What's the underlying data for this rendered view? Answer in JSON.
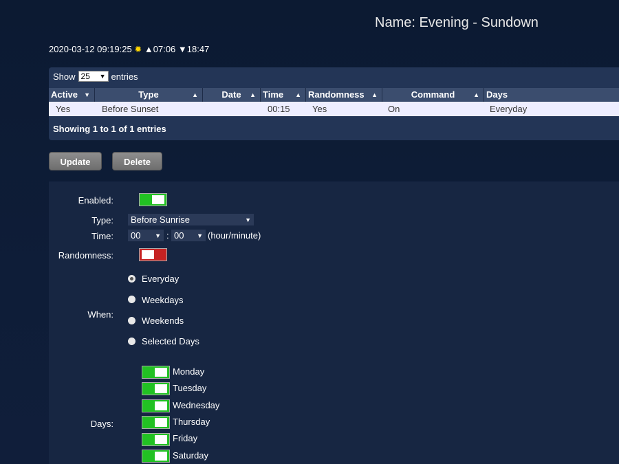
{
  "header": {
    "name_title": "Name: Evening - Sundown",
    "datetime": "2020-03-12 09:19:25",
    "sun_icon": "sun-icon",
    "sunrise": "▲07:06",
    "sunset": "▼18:47"
  },
  "table": {
    "show_label": "Show",
    "length_value": "25",
    "entries_label": "entries",
    "columns": [
      "Active",
      "Type",
      "Date",
      "Time",
      "Randomness",
      "Command",
      "Days"
    ],
    "rows": [
      [
        "Yes",
        "Before Sunset",
        "",
        "00:15",
        "Yes",
        "On",
        "Everyday"
      ]
    ],
    "info": "Showing 1 to 1 of 1 entries"
  },
  "buttons": {
    "update": "Update",
    "delete": "Delete"
  },
  "form": {
    "enabled_label": "Enabled:",
    "enabled": true,
    "type_label": "Type:",
    "type_value": "Before Sunrise",
    "time_label": "Time:",
    "hour_value": "00",
    "minute_value": "00",
    "time_separator": ":",
    "time_hint": "(hour/minute)",
    "randomness_label": "Randomness:",
    "randomness": false,
    "when_label": "When:",
    "when_options": [
      "Everyday",
      "Weekdays",
      "Weekends",
      "Selected Days"
    ],
    "when_selected": "Everyday",
    "days_label": "Days:",
    "days": [
      "Monday",
      "Tuesday",
      "Wednesday",
      "Thursday",
      "Friday",
      "Saturday"
    ]
  },
  "colors": {
    "toggle_on": "#22c123",
    "toggle_off": "#c62222",
    "sun": "#ffd400"
  }
}
